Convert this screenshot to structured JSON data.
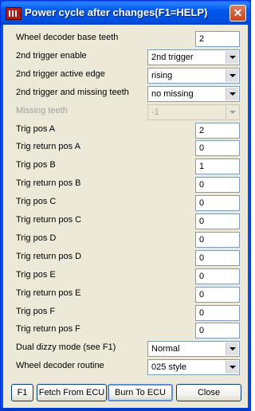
{
  "window": {
    "title": "Power cycle after changes(F1=HELP)",
    "close_glyph": "✕"
  },
  "fields": [
    {
      "label": "Wheel decoder base teeth",
      "type": "text",
      "value": "2"
    },
    {
      "label": "2nd trigger enable",
      "type": "select",
      "value": "2nd trigger"
    },
    {
      "label": "2nd trigger active edge",
      "type": "select",
      "value": "rising"
    },
    {
      "label": "2nd trigger and missing teeth",
      "type": "select",
      "value": "no missing"
    },
    {
      "label": "Missing teeth",
      "type": "select",
      "value": "-1",
      "disabled": true
    },
    {
      "label": "Trig pos A",
      "type": "text",
      "value": "2"
    },
    {
      "label": "Trig return pos A",
      "type": "text",
      "value": "0"
    },
    {
      "label": "Trig pos B",
      "type": "text",
      "value": "1"
    },
    {
      "label": "Trig return pos B",
      "type": "text",
      "value": "0"
    },
    {
      "label": "Trig pos C",
      "type": "text",
      "value": "0"
    },
    {
      "label": "Trig return pos C",
      "type": "text",
      "value": "0"
    },
    {
      "label": "Trig pos D",
      "type": "text",
      "value": "0"
    },
    {
      "label": "Trig return pos D",
      "type": "text",
      "value": "0"
    },
    {
      "label": "Trig pos E",
      "type": "text",
      "value": "0"
    },
    {
      "label": "Trig return pos E",
      "type": "text",
      "value": "0"
    },
    {
      "label": "Trig pos F",
      "type": "text",
      "value": "0"
    },
    {
      "label": "Trig return pos F",
      "type": "text",
      "value": "0"
    },
    {
      "label": "Dual dizzy mode (see F1)",
      "type": "select",
      "value": "Normal"
    },
    {
      "label": "Wheel decoder routine",
      "type": "select",
      "value": "025 style"
    }
  ],
  "buttons": {
    "f1": "F1",
    "fetch": "Fetch From ECU",
    "burn": "Burn To ECU",
    "close": "Close"
  }
}
